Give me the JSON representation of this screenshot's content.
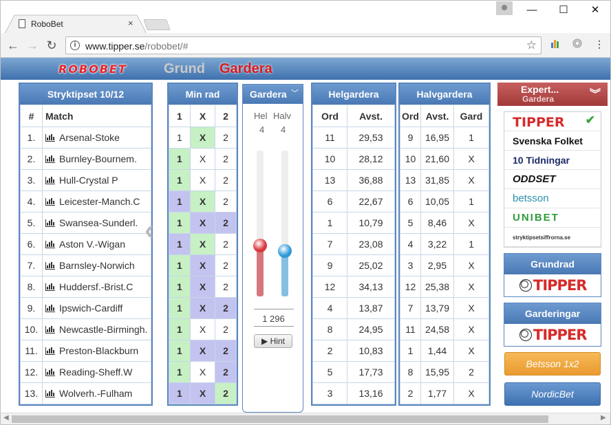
{
  "browser": {
    "tab_title": "RoboBet",
    "url_host": "www.tipper.se",
    "url_path": "/robobet/#",
    "win_min": "—",
    "win_max": "☐",
    "win_close": "✕",
    "back": "←",
    "forward": "→",
    "reload": "↻",
    "star": "☆",
    "info": "i",
    "tab_close": "×"
  },
  "app": {
    "logo": "ROBOBET",
    "nav": {
      "grund": "Grund",
      "gardera": "Gardera"
    }
  },
  "match_panel": {
    "title": "Stryktipset 10/12",
    "col_num": "#",
    "col_match": "Match",
    "rows": [
      {
        "n": "1.",
        "match": "Arsenal-Stoke"
      },
      {
        "n": "2.",
        "match": "Burnley-Bournem."
      },
      {
        "n": "3.",
        "match": "Hull-Crystal P"
      },
      {
        "n": "4.",
        "match": "Leicester-Manch.C"
      },
      {
        "n": "5.",
        "match": "Swansea-Sunderl."
      },
      {
        "n": "6.",
        "match": "Aston V.-Wigan"
      },
      {
        "n": "7.",
        "match": "Barnsley-Norwich"
      },
      {
        "n": "8.",
        "match": "Huddersf.-Brist.C"
      },
      {
        "n": "9.",
        "match": "Ipswich-Cardiff"
      },
      {
        "n": "10.",
        "match": "Newcastle-Birmingh."
      },
      {
        "n": "11.",
        "match": "Preston-Blackburn"
      },
      {
        "n": "12.",
        "match": "Reading-Sheff.W"
      },
      {
        "n": "13.",
        "match": "Wolverh.-Fulham"
      }
    ]
  },
  "minrad_panel": {
    "title": "Min rad",
    "cols": [
      "1",
      "X",
      "2"
    ],
    "rows": [
      [
        "off",
        "green",
        "off"
      ],
      [
        "green",
        "off",
        "off"
      ],
      [
        "green",
        "off",
        "off"
      ],
      [
        "purple",
        "green",
        "off"
      ],
      [
        "green",
        "purple",
        "purple"
      ],
      [
        "purple",
        "green",
        "off"
      ],
      [
        "green",
        "purple",
        "off"
      ],
      [
        "green",
        "purple",
        "off"
      ],
      [
        "green",
        "purple",
        "purple"
      ],
      [
        "green",
        "off",
        "off"
      ],
      [
        "green",
        "purple",
        "purple"
      ],
      [
        "green",
        "off",
        "purple"
      ],
      [
        "purple",
        "purple",
        "green"
      ]
    ]
  },
  "gardera_panel": {
    "title": "Gardera",
    "hel_label": "Hel",
    "halv_label": "Halv",
    "hel_value": "4",
    "halv_value": "4",
    "hel_level": 0.35,
    "halv_level": 0.31,
    "hel_color": "#d9383d",
    "halv_color": "#2f9ad9",
    "total": "1 296",
    "hint_label": "▶ Hint"
  },
  "helgardera_panel": {
    "title": "Helgardera",
    "col_ord": "Ord",
    "col_avst": "Avst.",
    "rows": [
      [
        "11",
        "29,53"
      ],
      [
        "10",
        "28,12"
      ],
      [
        "13",
        "36,88"
      ],
      [
        "6",
        "22,67"
      ],
      [
        "1",
        "10,79"
      ],
      [
        "7",
        "23,08"
      ],
      [
        "9",
        "25,02"
      ],
      [
        "12",
        "34,13"
      ],
      [
        "4",
        "13,87"
      ],
      [
        "8",
        "24,95"
      ],
      [
        "2",
        "10,83"
      ],
      [
        "5",
        "17,73"
      ],
      [
        "3",
        "13,16"
      ]
    ]
  },
  "halvgardera_panel": {
    "title": "Halvgardera",
    "col_ord": "Ord",
    "col_avst": "Avst.",
    "col_gard": "Gard",
    "rows": [
      [
        "9",
        "16,95",
        "1"
      ],
      [
        "10",
        "21,60",
        "X"
      ],
      [
        "13",
        "31,85",
        "X"
      ],
      [
        "6",
        "10,05",
        "1"
      ],
      [
        "5",
        "8,46",
        "X"
      ],
      [
        "4",
        "3,22",
        "1"
      ],
      [
        "3",
        "2,95",
        "X"
      ],
      [
        "12",
        "25,38",
        "X"
      ],
      [
        "7",
        "13,79",
        "X"
      ],
      [
        "11",
        "24,58",
        "X"
      ],
      [
        "1",
        "1,44",
        "X"
      ],
      [
        "8",
        "15,95",
        "2"
      ],
      [
        "2",
        "1,77",
        "X"
      ]
    ]
  },
  "expert": {
    "title": "Expert...",
    "subtitle": "Gardera",
    "sources": [
      {
        "name": "TIPPER",
        "color": "#d62b2b",
        "selected": true
      },
      {
        "name": "Svenska Folket",
        "color": "#111111"
      },
      {
        "name": "10 Tidningar",
        "color": "#1a2a66"
      },
      {
        "name": "ODDSET",
        "color": "#111111"
      },
      {
        "name": "betsson",
        "color": "#2a8fa8"
      },
      {
        "name": "UNIBET",
        "color": "#2e9a3a"
      },
      {
        "name": "stryktipsetsiffrorna.se",
        "color": "#333333"
      }
    ]
  },
  "grundrad": {
    "title": "Grundrad",
    "logo": "TIPPER"
  },
  "garderingar": {
    "title": "Garderingar",
    "logo": "TIPPER"
  },
  "buttons": {
    "betsson": "Betsson 1x2",
    "nordic": "NordicBet"
  }
}
